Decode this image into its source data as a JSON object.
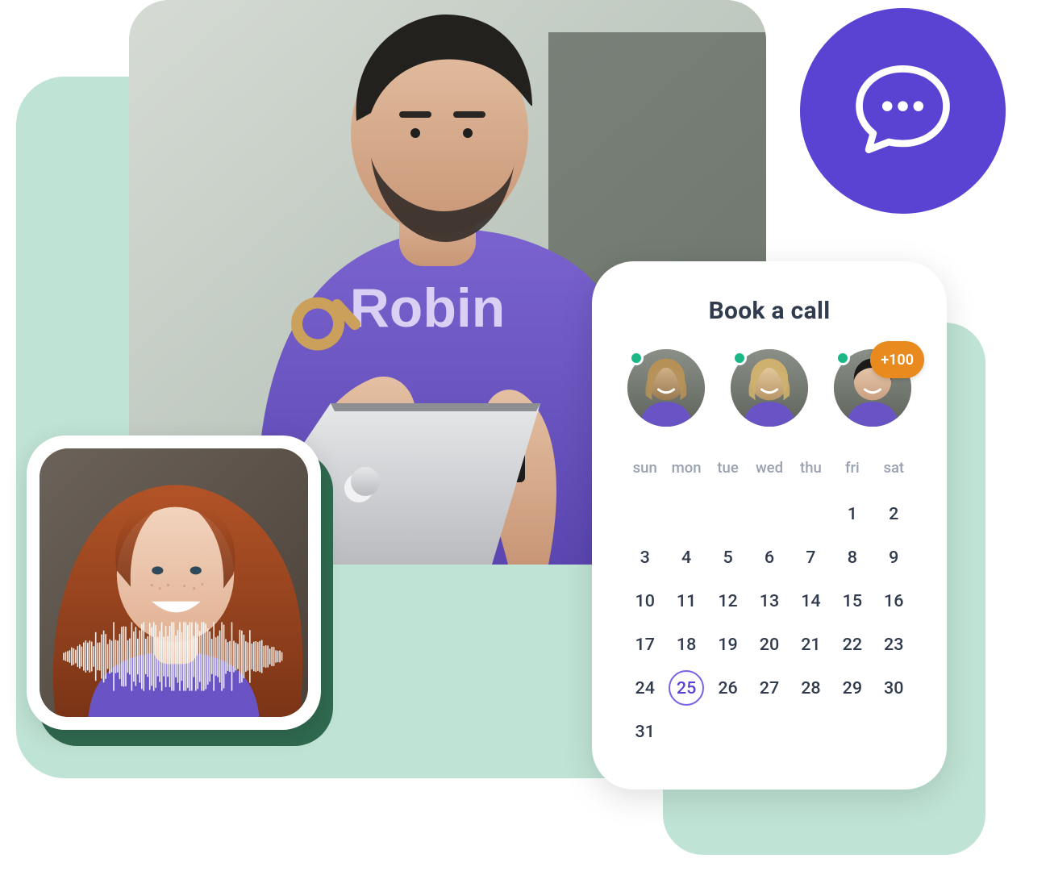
{
  "colors": {
    "mint": "#bfe3d4",
    "dark_green": "#2f6a4f",
    "brand_purple": "#5a42d3",
    "badge_orange": "#e98a1f",
    "status_green": "#1ab886"
  },
  "hero": {
    "brand_text": "Robin"
  },
  "chat_button": {
    "label": "Chat"
  },
  "voice_card": {
    "subject": "person-smiling"
  },
  "calendar": {
    "title": "Book a call",
    "avatars": [
      {
        "status": "online"
      },
      {
        "status": "online"
      },
      {
        "status": "online",
        "badge": "+100"
      }
    ],
    "day_headers": [
      "sun",
      "mon",
      "tue",
      "wed",
      "thu",
      "fri",
      "sat"
    ],
    "blanks_before": 5,
    "days_in_month": 31,
    "selected_day": 25
  }
}
